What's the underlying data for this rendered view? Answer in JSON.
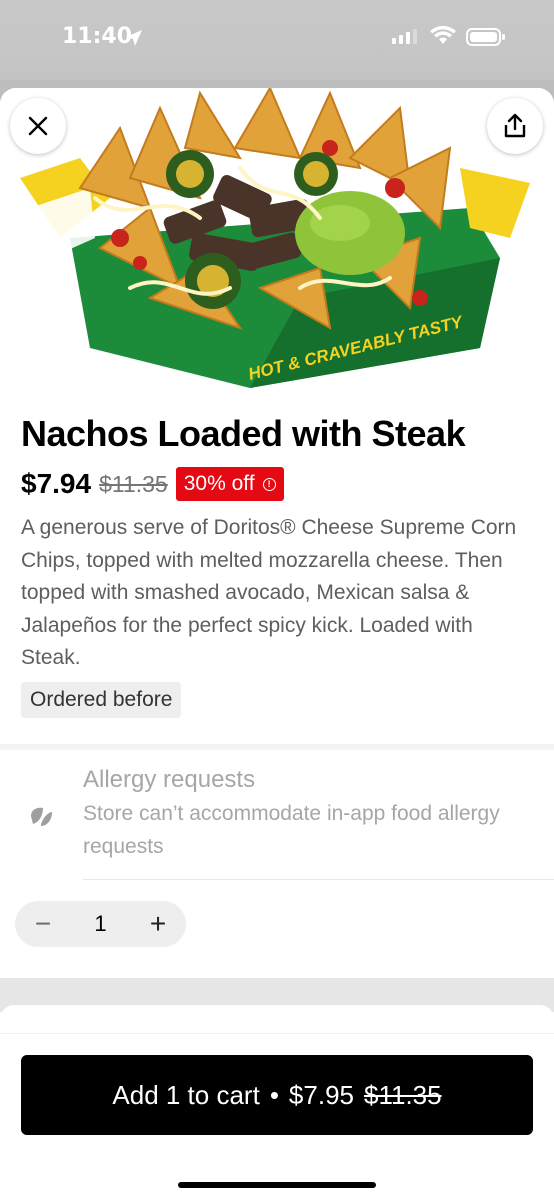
{
  "status_bar": {
    "time": "11:40",
    "icons": [
      "location-arrow-icon",
      "signal-icon",
      "wifi-icon",
      "battery-icon"
    ]
  },
  "header": {
    "close_icon": "close-icon",
    "share_icon": "share-icon"
  },
  "hero_image": {
    "box_text": "HOT & CRAVEABLY TASTY"
  },
  "item": {
    "title": "Nachos Loaded with Steak",
    "price": "$7.94",
    "original_price": "$11.35",
    "discount": "30% off",
    "description": "A generous serve of Doritos® Cheese Supreme Corn Chips, topped with melted mozzarella cheese. Then topped with smashed avocado, Mexican salsa & Jalapeños for the perfect spicy kick. Loaded with Steak.",
    "ordered_chip": "Ordered before"
  },
  "allergy": {
    "title": "Allergy requests",
    "text": "Store can’t accommodate in-app food allergy requests"
  },
  "quantity": {
    "minus": "−",
    "value": "1",
    "plus": "+"
  },
  "cart": {
    "label": "Add 1 to cart",
    "separator": "•",
    "price": "$7.95",
    "original_price": "$11.35"
  },
  "colors": {
    "discount_badge": "#e50914",
    "cart_button": "#000000",
    "brand_green": "#1d8c3a",
    "brand_yellow": "#f4d21f"
  }
}
